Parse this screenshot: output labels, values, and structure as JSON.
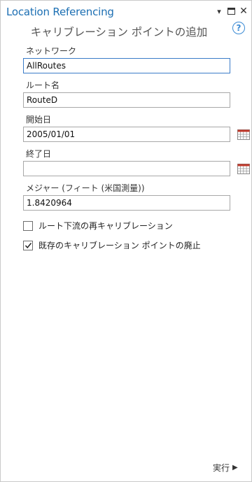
{
  "titlebar": {
    "app_title": "Location Referencing",
    "dropdown_icon": "▾",
    "maximize_icon": "▭",
    "close_icon": "✕"
  },
  "tool": {
    "title": "キャリブレーション ポイントの追加",
    "help_icon": "?"
  },
  "form": {
    "network": {
      "label": "ネットワーク",
      "value": "AllRoutes"
    },
    "route_name": {
      "label": "ルート名",
      "value": "RouteD"
    },
    "start_date": {
      "label": "開始日",
      "value": "2005/01/01"
    },
    "end_date": {
      "label": "終了日",
      "value": ""
    },
    "measure": {
      "label": "メジャー (フィート (米国測量))",
      "value": "1.8420964"
    },
    "recalibrate_downstream": {
      "label": "ルート下流の再キャリブレーション",
      "checked": false
    },
    "retire_existing": {
      "label": "既存のキャリブレーション ポイントの廃止",
      "checked": true
    }
  },
  "footer": {
    "run_label": "実行",
    "run_icon": "▶"
  },
  "colors": {
    "accent": "#1c6fb3",
    "help": "#3a8ad4",
    "active_border": "#3a7bc8"
  }
}
